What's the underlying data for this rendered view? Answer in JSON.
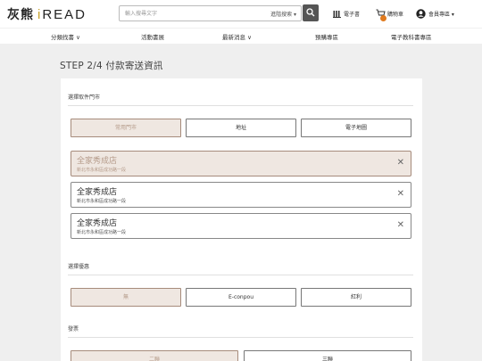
{
  "header": {
    "logo_cn": "灰熊",
    "logo_en_first": "i",
    "logo_en_rest": "READ",
    "search_placeholder": "輸入搜尋文字",
    "advanced_search": "進階搜索 ▾",
    "ebook": "電子書",
    "cart": "購物車",
    "member": "會員專區 ▾"
  },
  "nav": [
    "分類找書 ∨",
    "活動書展",
    "最新消息 ∨",
    "預購專區",
    "電子教科書專區"
  ],
  "page": {
    "step_title": "STEP 2/4  付款寄送資訊"
  },
  "pickup": {
    "label": "選擇取件門市",
    "tabs": [
      "常用門市",
      "地址",
      "電子地圖"
    ],
    "stores": [
      {
        "name": "全家秀成店",
        "address": "新北市永和區成功路一段",
        "selected": true
      },
      {
        "name": "全家秀成店",
        "address": "新北市永和區成功路一段",
        "selected": false
      },
      {
        "name": "全家秀成店",
        "address": "新北市永和區成功路一段",
        "selected": false
      }
    ],
    "close_glyph": "✕"
  },
  "discount": {
    "label": "選擇優惠",
    "options": [
      "無",
      "E-conpou",
      "紅利"
    ]
  },
  "invoice": {
    "label": "發票",
    "options": [
      "二聯",
      "三聯"
    ]
  },
  "colors": {
    "selected_bg": "#efe7e1",
    "selected_border": "#a68b7b",
    "brand_gold": "#c8a22a",
    "cart_badge": "#e07a1e"
  }
}
